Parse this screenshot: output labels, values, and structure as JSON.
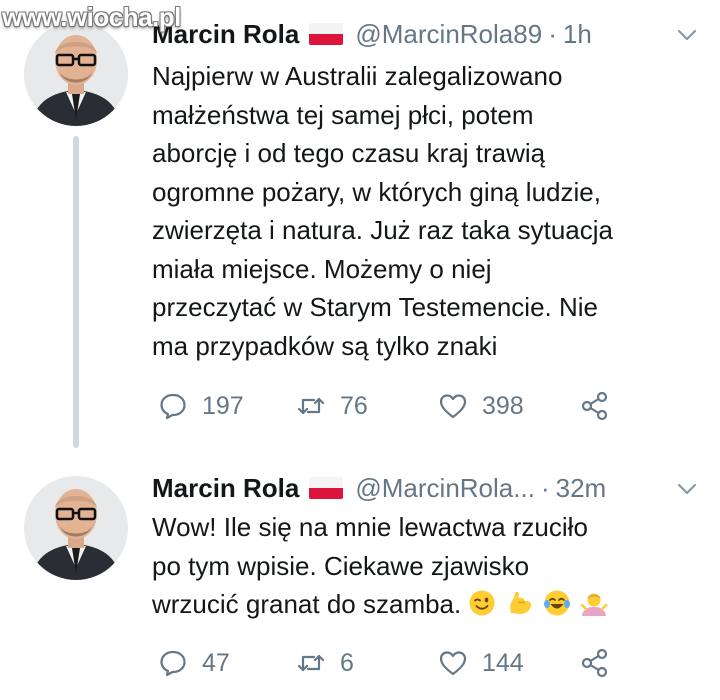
{
  "watermark": "www.wiocha.pl",
  "colors": {
    "text": "#14171a",
    "muted": "#657786",
    "thread_line": "#cfd9de",
    "flag_white": "#f4f4f4",
    "flag_red": "#dc143c"
  },
  "tweets": [
    {
      "author_name": "Marcin Rola",
      "flag": "poland-flag",
      "handle": "@MarcinRola89",
      "separator": "·",
      "time": "1h",
      "text_lines": [
        "Najpierw w Australii zalegalizowano",
        "małżeństwa tej samej płci, potem",
        "aborcję i od tego czasu kraj trawią",
        "ogromne pożary, w których giną ludzie,",
        "zwierzęta i natura. Już raz taka sytuacja",
        "miała miejsce. Możemy o niej",
        "przeczytać w Starym Testemencie. Nie",
        "ma przypadków są tylko znaki"
      ],
      "replies": "197",
      "retweets": "76",
      "likes": "398"
    },
    {
      "author_name": "Marcin Rola",
      "flag": "poland-flag",
      "handle": "@MarcinRola...",
      "separator": "·",
      "time": "32m",
      "text_lines": [
        "Wow! Ile się na mnie lewactwa rzuciło",
        "po tym wpisie. Ciekawe zjawisko",
        "wrzucić granat do szamba."
      ],
      "emojis": [
        "winking-face-emoji",
        "flexed-biceps-emoji",
        "tears-of-joy-emoji",
        "person-shrugging-emoji"
      ],
      "replies": "47",
      "retweets": "6",
      "likes": "144"
    }
  ]
}
